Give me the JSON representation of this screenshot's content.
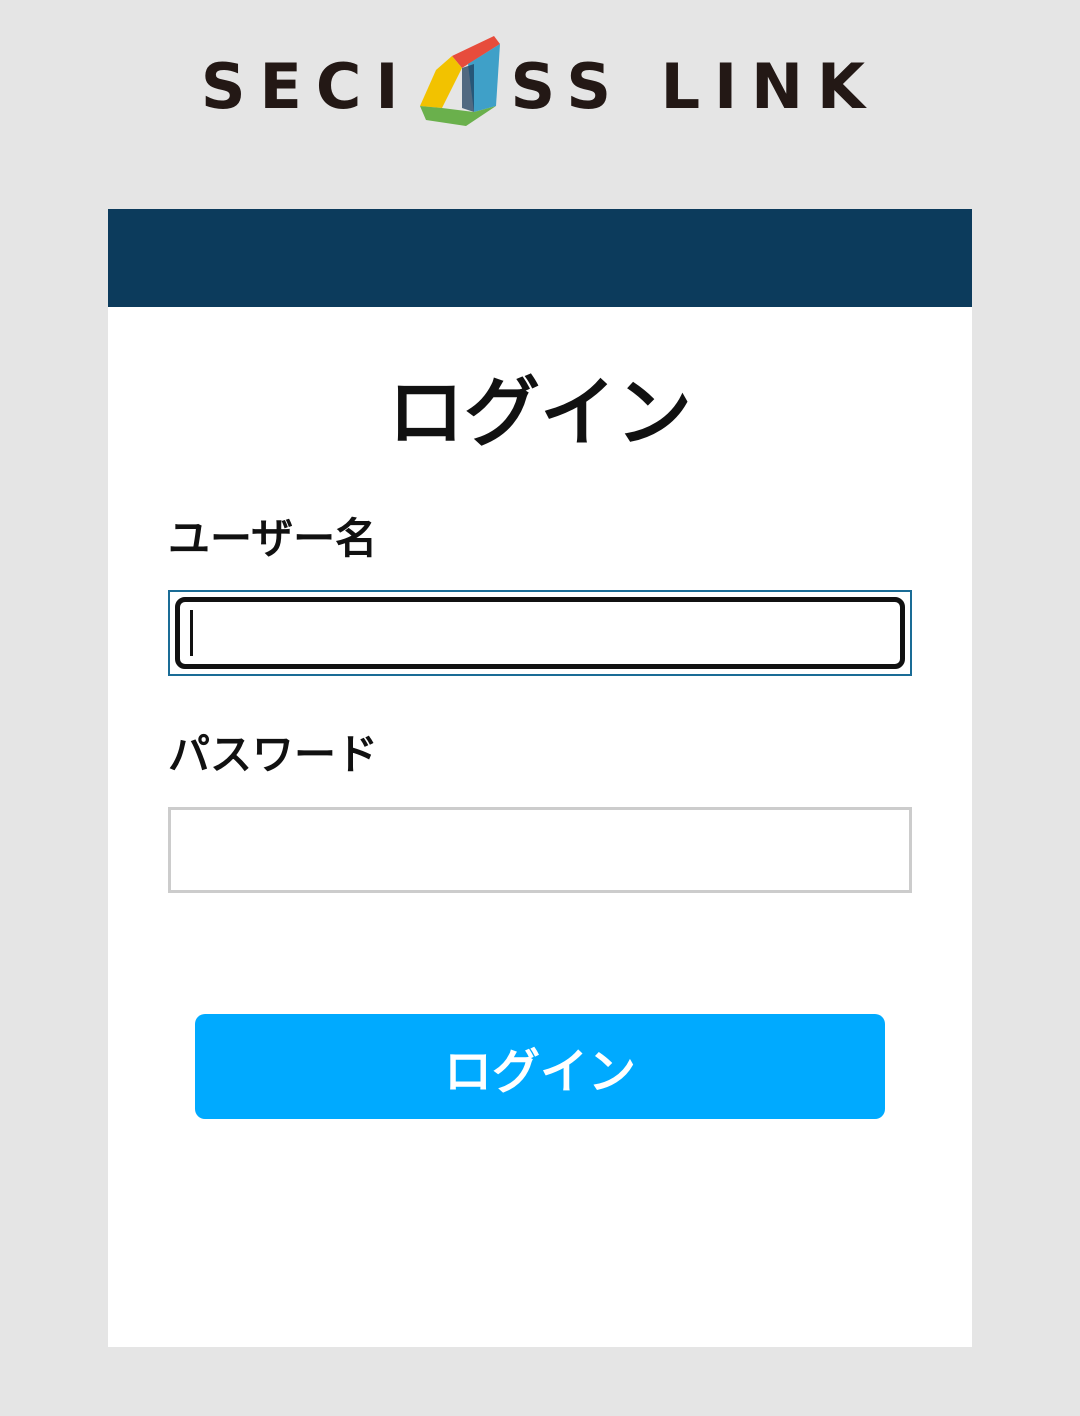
{
  "brand": {
    "logo_left": "SECI",
    "logo_right": "SS LINK",
    "mark_icon": "secioss-mark-icon",
    "colors": {
      "red": "#e74c3c",
      "blue": "#3fa0c8",
      "yellow": "#f2c200",
      "green": "#6ab04c",
      "text": "#231815"
    }
  },
  "header": {
    "color": "#0c3b5c"
  },
  "login_form": {
    "title": "ログイン",
    "username_label": "ユーザー名",
    "username_value": "",
    "password_label": "パスワード",
    "password_value": "",
    "submit_label": "ログイン",
    "submit_color": "#00aaff"
  }
}
